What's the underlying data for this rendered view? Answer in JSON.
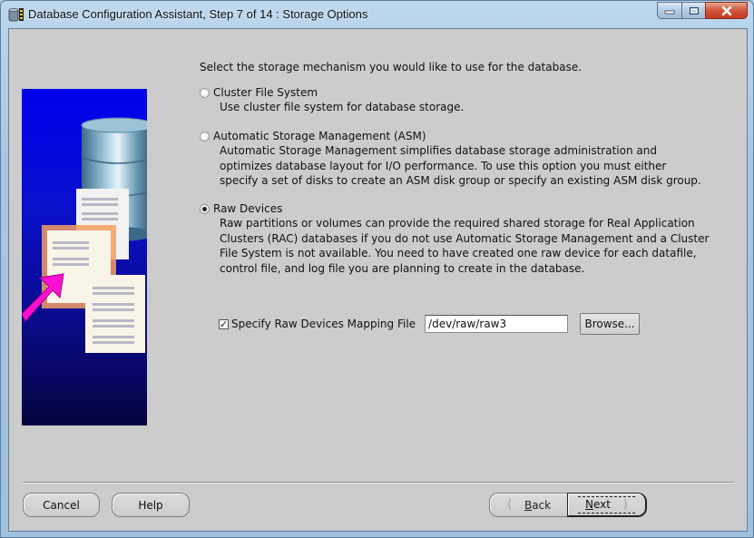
{
  "window": {
    "title": "Database Configuration Assistant, Step 7 of 14 : Storage Options",
    "controls": {
      "minimize": "minimize",
      "maximize": "maximize",
      "close": "close"
    }
  },
  "main": {
    "intro": "Select the storage mechanism you would like to use for the database.",
    "options": [
      {
        "label": "Cluster File System",
        "selected": false,
        "description": [
          "Use cluster file system for database storage."
        ]
      },
      {
        "label": "Automatic Storage Management (ASM)",
        "selected": false,
        "description": [
          "Automatic Storage Management simplifies database storage administration and",
          "optimizes database layout for I/O performance. To use this option you must either",
          "specify a set of disks to create an ASM disk group or specify an existing ASM disk group."
        ]
      },
      {
        "label": "Raw Devices",
        "selected": true,
        "description": [
          "Raw partitions or volumes can provide the required shared storage for Real Application",
          "Clusters (RAC) databases if you do not use Automatic Storage Management and a Cluster",
          "File System is not available.  You need to have created one raw device for each datafile,",
          "control file, and log file you are planning to create in the database."
        ]
      }
    ],
    "mapping": {
      "checkbox_label": "Specify Raw Devices Mapping File",
      "checked": true,
      "path_value": "/dev/raw/raw3",
      "browse_label": "Browse..."
    }
  },
  "footer": {
    "cancel_label": "Cancel",
    "help_label": "Help",
    "back_mnemonic": "B",
    "back_rest": "ack",
    "next_mnemonic": "N",
    "next_rest": "ext"
  },
  "colors": {
    "dialog_bg": "#cccccc",
    "banner_blue": "#0000ee",
    "arrow_magenta": "#ff00cc",
    "close_red": "#c94a2e"
  }
}
